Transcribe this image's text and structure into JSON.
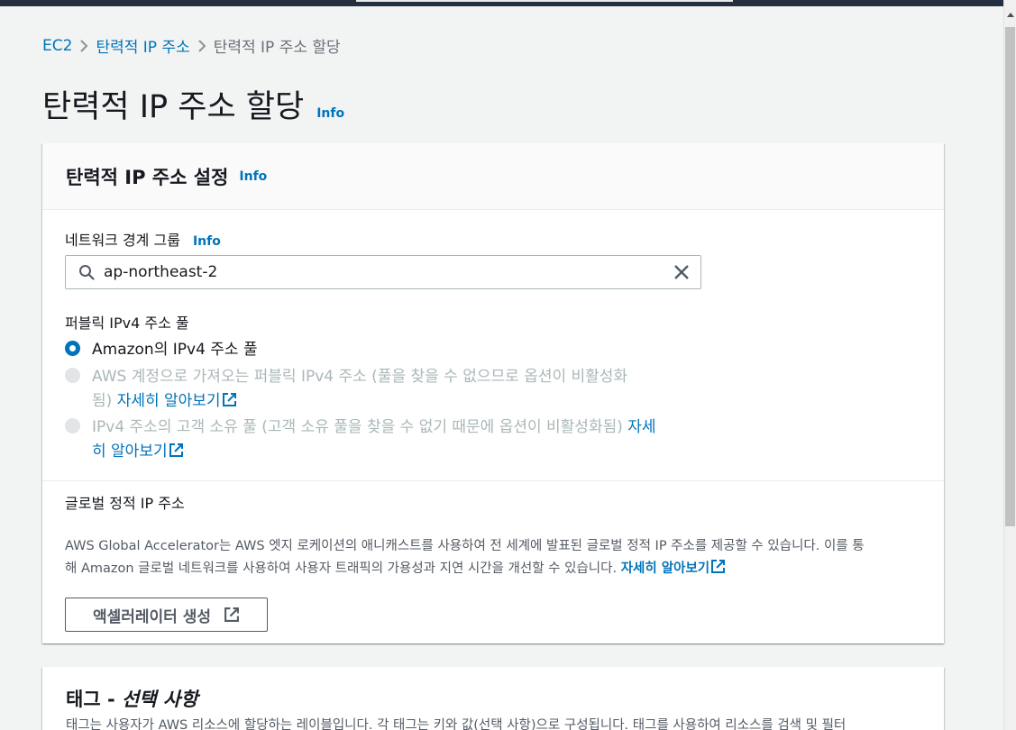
{
  "colors": {
    "link": "#0073bb",
    "radio_selected": "#0073bb",
    "header_bar": "#232f3e"
  },
  "breadcrumb": {
    "items": [
      {
        "label": "EC2"
      },
      {
        "label": "탄력적 IP 주소"
      },
      {
        "label": "탄력적 IP 주소 할당"
      }
    ]
  },
  "page": {
    "title": "탄력적 IP 주소 할당",
    "info": "Info"
  },
  "settings": {
    "title": "탄력적 IP 주소 설정",
    "info": "Info",
    "network_border_group": {
      "label": "네트워크 경계 그룹",
      "info": "Info",
      "value": "ap-northeast-2"
    },
    "ipv4_pool": {
      "label": "퍼블릭 IPv4 주소 풀",
      "options": [
        {
          "line1": "Amazon의 IPv4 주소 풀",
          "selected": true,
          "disabled": false
        },
        {
          "line1": "AWS 계정으로 가져오는 퍼블릭 IPv4 주소 (풀을 찾을 수 없으므로 옵션이 비활성화",
          "line2": "됨)",
          "link": "자세히 알아보기",
          "selected": false,
          "disabled": true
        },
        {
          "line1": "IPv4 주소의 고객 소유 풀 (고객 소유 풀을 찾을 수 없기 때문에 옵션이 비활성화됨)",
          "link1": "자세",
          "link2": "히 알아보기",
          "selected": false,
          "disabled": true
        }
      ]
    },
    "global_static": {
      "label": "글로벌 정적 IP 주소",
      "desc_line1": "AWS Global Accelerator는 AWS 엣지 로케이션의 애니캐스트를 사용하여 전 세계에 발표된 글로벌 정적 IP 주소를 제공할 수 있습니다. 이를 통",
      "desc_line2": "해 Amazon 글로벌 네트워크를 사용하여 사용자 트래픽의 가용성과 지연 시간을 개선할 수 있습니다.",
      "link": "자세히 알아보기",
      "button": "액셀러레이터 생성"
    }
  },
  "tags": {
    "title": "태그 - ",
    "title_optional": "선택 사항",
    "desc": "태그는 사용자가 AWS 리소스에 할당하는 레이블입니다. 각 태그는 키와 값(선택 사항)으로 구성됩니다. 태그를 사용하여 리소스를 검색 및 필터"
  }
}
